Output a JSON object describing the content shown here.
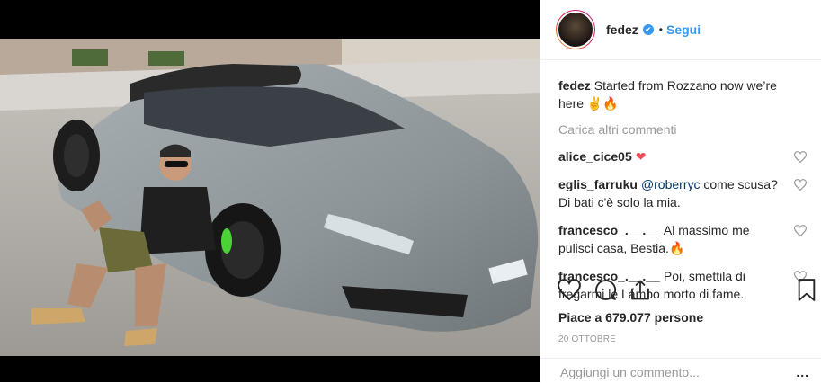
{
  "post": {
    "username": "fedez",
    "verified": "✔",
    "separator": "•",
    "follow_label": "Segui"
  },
  "caption": {
    "username": "fedez",
    "text": "Started from Rozzano now we’re here ✌🔥"
  },
  "load_more_label": "Carica altri commenti",
  "comments": [
    {
      "username": "alice_cice05",
      "text": "❤"
    },
    {
      "username": "eglis_farruku",
      "mention": "@roberryc",
      "text": "come scusa? Di bati c'è solo la mia."
    },
    {
      "username": "francesco_.__.__",
      "text": "Al massimo me pulisci casa, Bestia.🔥"
    },
    {
      "username": "francesco_.__.__",
      "text": "Poi, smettila di fregarmi le Lambo morto di fame."
    }
  ],
  "likes_text": "Piace a 679.077 persone",
  "date_text": "20 OTTOBRE",
  "comment_input": {
    "placeholder": "Aggiungi un commento..."
  },
  "more_options": "...",
  "icons": [
    "heart-icon",
    "comment-icon",
    "share-icon",
    "bookmark-icon",
    "verified-icon"
  ],
  "colors": {
    "accent": "#3897f0",
    "muted": "#999999",
    "heart_red": "#ed4956"
  }
}
